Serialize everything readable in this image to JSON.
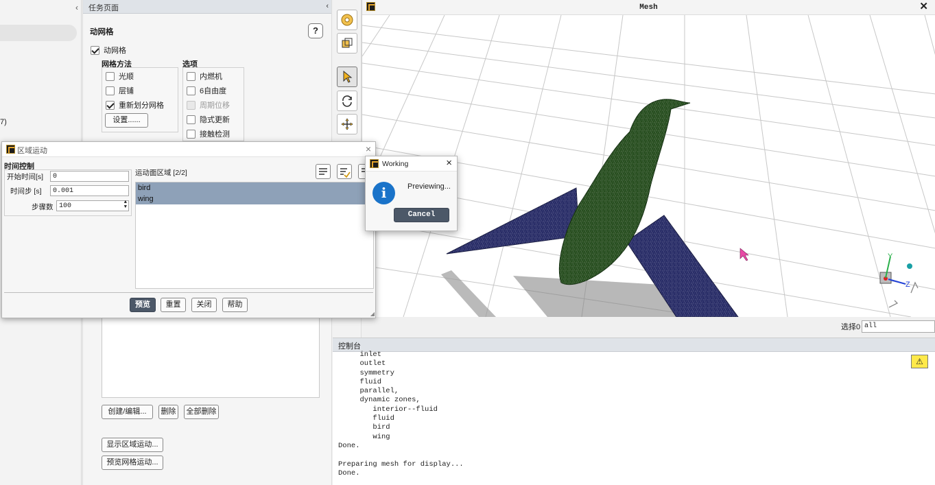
{
  "left_panel": {
    "collapse_glyph": "‹",
    "fragment_text": "7)"
  },
  "task_page": {
    "title": "任务页面",
    "collapse_glyph": "‹",
    "section_title": "动网格",
    "help_label": "?",
    "dynamic_mesh_checkbox": {
      "label": "动网格",
      "checked": true
    },
    "mesh_methods": {
      "title": "网格方法",
      "items": [
        {
          "label": "光顺",
          "checked": false
        },
        {
          "label": "层铺",
          "checked": false
        },
        {
          "label": "重新划分网格",
          "checked": true
        }
      ],
      "settings_button": "设置......"
    },
    "options": {
      "title": "选项",
      "items": [
        {
          "label": "内燃机",
          "checked": false
        },
        {
          "label": "6自由度",
          "checked": false
        },
        {
          "label": "周期位移",
          "checked": false,
          "disabled": true
        },
        {
          "label": "隐式更新",
          "checked": false
        },
        {
          "label": "接触检测",
          "checked": false
        }
      ]
    },
    "buttons": {
      "create_edit": "创建/编辑...",
      "delete": "删除",
      "delete_all": "全部删除",
      "display_zone_motion": "显示区域运动...",
      "preview_mesh_motion": "预览网格运动..."
    }
  },
  "zone_motion_dialog": {
    "title": "区域运动",
    "close_glyph": "×",
    "time_control_title": "时间控制",
    "start_time": {
      "label": "开始时间[s]",
      "value": "0"
    },
    "time_step": {
      "label": "时间步 [s]",
      "value": "0.001"
    },
    "steps": {
      "label": "步骤数",
      "value": "100"
    },
    "zones": {
      "label": "运动面区域 [2/2]",
      "items": [
        "bird",
        "wing"
      ]
    },
    "buttons": {
      "preview": "预览",
      "reset": "重置",
      "close": "关闭",
      "help": "帮助"
    }
  },
  "working_dialog": {
    "title": "Working",
    "close_glyph": "×",
    "icon_glyph": "i",
    "message": "Previewing...",
    "cancel": "Cancel"
  },
  "toolbar": {
    "icons": [
      "camera-icon",
      "graphics-icon",
      "select-arrow-icon",
      "rotate-icon",
      "pan-icon"
    ]
  },
  "mesh_window": {
    "title": "Mesh",
    "close_glyph": "✕",
    "selection_label": "选择0",
    "selection_value": "all",
    "triad_labels": {
      "y": "Y",
      "z": "Z"
    }
  },
  "console": {
    "title": "控制台",
    "warn_glyph": "⚠",
    "lines": [
      "     inlet",
      "     outlet",
      "     symmetry",
      "     fluid",
      "     parallel,",
      "     dynamic zones,",
      "        interior--fluid",
      "        fluid",
      "        bird",
      "        wing",
      "Done.",
      "",
      "Preparing mesh for display...",
      "Done."
    ]
  },
  "colors": {
    "bird_body": "#264d1e",
    "wing": "#272b66",
    "accent": "#4c5868",
    "selection": "#8ea1b8",
    "info": "#1a73c9"
  }
}
